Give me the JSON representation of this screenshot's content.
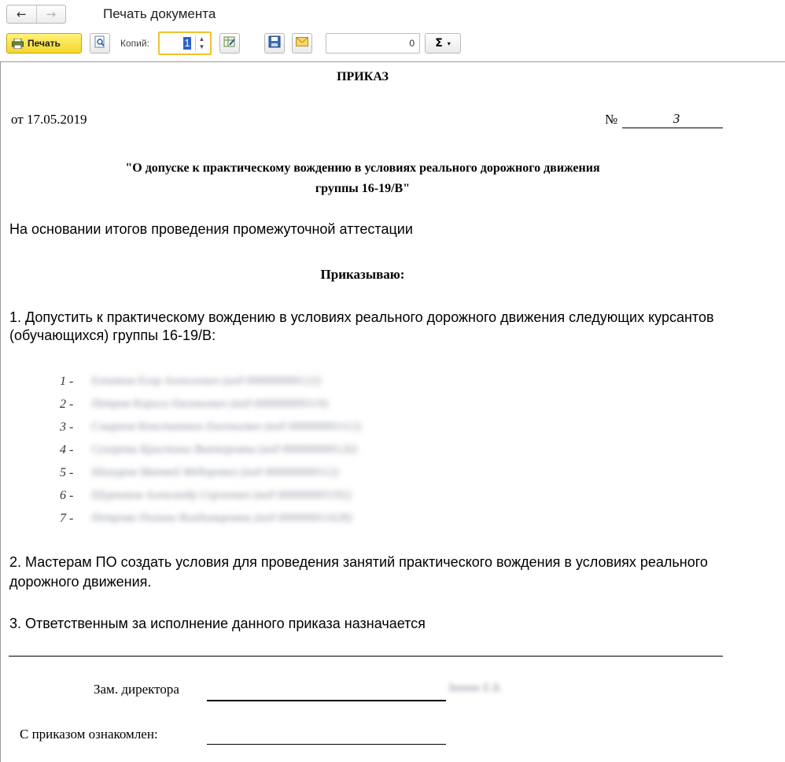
{
  "window": {
    "title": "Печать документа",
    "back_icon": "←",
    "forward_icon": "→"
  },
  "toolbar": {
    "print_label": "Печать",
    "copies_label": "Копий:",
    "copies_value": "1",
    "sum_value": "0",
    "sigma_label": "Σ",
    "dropdown_icon": "▾",
    "accent_color": "#f5d62b"
  },
  "document": {
    "title": "ПРИКАЗ",
    "date": "от  17.05.2019",
    "number_sign": "№",
    "number": "3",
    "subject_line1": "\"О допуске к практическому вождению в условиях реального дорожного движения",
    "subject_line2": "группы  16-19/В\"",
    "basis": "На основании итогов проведения промежуточной аттестации",
    "order_word": "Приказываю:",
    "item1": "1. Допустить к практическому вождению в условиях реального дорожного движения следующих курсантов (обучающихся) группы 16-19/В:",
    "students": [
      {
        "num": "1 -",
        "name": "Елпатов Егор Алексеевич (код 000000000122)"
      },
      {
        "num": "2 -",
        "name": "Петров Кирилл Евгеньевич (код 000000000119)"
      },
      {
        "num": "3 -",
        "name": "Смирнов Константин Евгеньевич (код 000000001112)"
      },
      {
        "num": "4 -",
        "name": "Сухорева Кристина Викторовна (код 000000000126)"
      },
      {
        "num": "5 -",
        "name": "Шахуров Матвей Фёдорович (код 000000000112)"
      },
      {
        "num": "6 -",
        "name": "Шурников Александр Сергеевич (код 000000001192)"
      },
      {
        "num": "7 -",
        "name": "Петрова Полина Владимировна (код 000000011628)"
      }
    ],
    "item2": "2. Мастерам ПО создать условия для проведения занятий практического вождения в условиях реального дорожного движения.",
    "item3": "3. Ответственным за исполнение данного приказа назначается",
    "signer_title": "Зам.  директора",
    "signer_name": "Зимин Е.Б.",
    "ack_label": "С приказом ознакомлен:"
  }
}
